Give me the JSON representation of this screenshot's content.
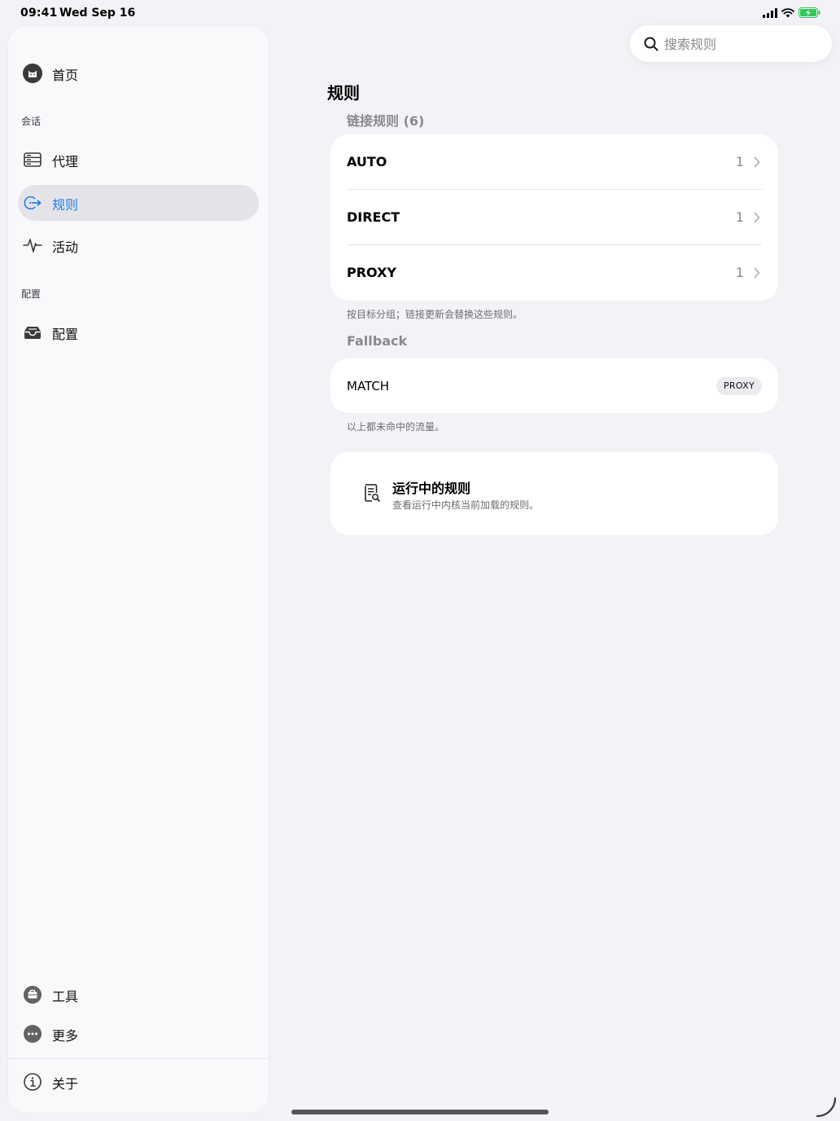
{
  "status_bar": {
    "time": "09:41",
    "date": "Wed Sep 16"
  },
  "sidebar": {
    "home": "首页",
    "section_session": "会话",
    "proxy": "代理",
    "rules": "规则",
    "activity": "活动",
    "section_config": "配置",
    "config": "配置",
    "tools": "工具",
    "more": "更多",
    "about": "关于"
  },
  "search": {
    "placeholder": "搜索规则",
    "value": ""
  },
  "main": {
    "title": "规则",
    "link_rules_header": "链接规则 (6)",
    "rows": [
      {
        "label": "AUTO",
        "count": "1"
      },
      {
        "label": "DIRECT",
        "count": "1"
      },
      {
        "label": "PROXY",
        "count": "1"
      }
    ],
    "link_rules_footnote": "按目标分组；链接更新会替换这些规则。",
    "fallback_header": "Fallback",
    "fallback": {
      "label": "MATCH",
      "badge": "PROXY"
    },
    "fallback_footnote": "以上都未命中的流量。",
    "running": {
      "title": "运行中的规则",
      "subtitle": "查看运行中内核当前加载的规则。"
    }
  },
  "colors": {
    "accent": "#1f7de6",
    "background": "#f2f2f7",
    "card": "#ffffff",
    "battery": "#34c759"
  },
  "icons": [
    "cat-icon",
    "server-icon",
    "arrow-circle-icon",
    "waveform-icon",
    "tray-icon",
    "toolbox-icon",
    "ellipsis-icon",
    "info-icon",
    "search-icon",
    "chevron-right-icon",
    "doc-search-icon"
  ]
}
